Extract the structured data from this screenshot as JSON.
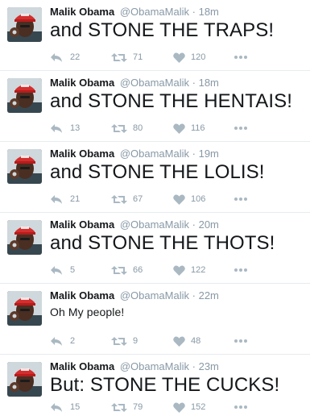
{
  "colors": {
    "name": "#14171a",
    "meta": "#8899a6",
    "icon": "#aab8c2",
    "divider": "#e6ecf0"
  },
  "tweets": [
    {
      "name": "Malik Obama",
      "handle": "@ObamaMalik",
      "dot": "·",
      "time": "18m",
      "text": "and STONE THE TRAPS!",
      "size": "large",
      "replies": "22",
      "retweets": "71",
      "likes": "120"
    },
    {
      "name": "Malik Obama",
      "handle": "@ObamaMalik",
      "dot": "·",
      "time": "18m",
      "text": "and STONE THE HENTAIS!",
      "size": "large",
      "replies": "13",
      "retweets": "80",
      "likes": "116"
    },
    {
      "name": "Malik Obama",
      "handle": "@ObamaMalik",
      "dot": "·",
      "time": "19m",
      "text": "and STONE THE LOLIS!",
      "size": "large",
      "replies": "21",
      "retweets": "67",
      "likes": "106"
    },
    {
      "name": "Malik Obama",
      "handle": "@ObamaMalik",
      "dot": "·",
      "time": "20m",
      "text": "and STONE THE THOTS!",
      "size": "large",
      "replies": "5",
      "retweets": "66",
      "likes": "122"
    },
    {
      "name": "Malik Obama",
      "handle": "@ObamaMalik",
      "dot": "·",
      "time": "22m",
      "text": "Oh My people!",
      "size": "small",
      "replies": "2",
      "retweets": "9",
      "likes": "48"
    },
    {
      "name": "Malik Obama",
      "handle": "@ObamaMalik",
      "dot": "·",
      "time": "23m",
      "text": "But: STONE THE CUCKS!",
      "size": "large",
      "replies": "15",
      "retweets": "79",
      "likes": "152"
    }
  ]
}
